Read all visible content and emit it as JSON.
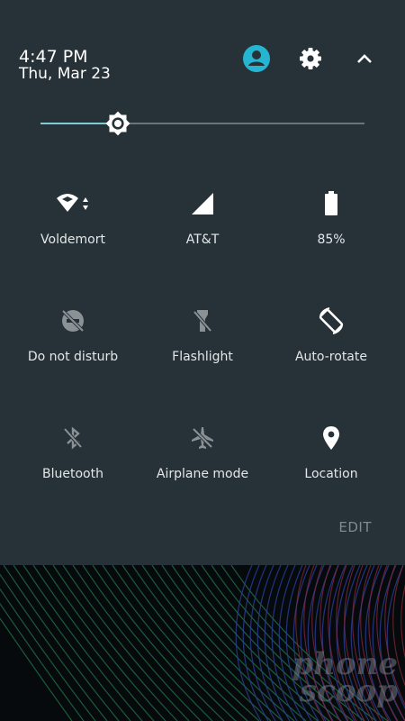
{
  "header": {
    "time": "4:47 PM",
    "date": "Thu, Mar 23",
    "icons": [
      "account-icon",
      "gear-icon",
      "chevron-up-icon"
    ]
  },
  "brightness": {
    "level": 0.24,
    "icon": "brightness-icon"
  },
  "tiles": [
    {
      "label": "Voldemort",
      "icon": "wifi-icon",
      "active": true
    },
    {
      "label": "AT&T",
      "icon": "cell-signal-icon",
      "active": true
    },
    {
      "label": "85%",
      "icon": "battery-icon",
      "active": true
    },
    {
      "label": "Do not disturb",
      "icon": "do-not-disturb-icon",
      "active": false
    },
    {
      "label": "Flashlight",
      "icon": "flashlight-icon",
      "active": false
    },
    {
      "label": "Auto-rotate",
      "icon": "auto-rotate-icon",
      "active": true
    },
    {
      "label": "Bluetooth",
      "icon": "bluetooth-off-icon",
      "active": false
    },
    {
      "label": "Airplane mode",
      "icon": "airplane-icon",
      "active": false
    },
    {
      "label": "Location",
      "icon": "location-pin-icon",
      "active": true
    }
  ],
  "edit_label": "EDIT",
  "watermark": {
    "line1": "phone",
    "line2": "scoop"
  },
  "colors": {
    "panel": "#263238",
    "accent": "#7fcbd4",
    "account": "#26b5d1",
    "inactive": "#8a9296"
  }
}
